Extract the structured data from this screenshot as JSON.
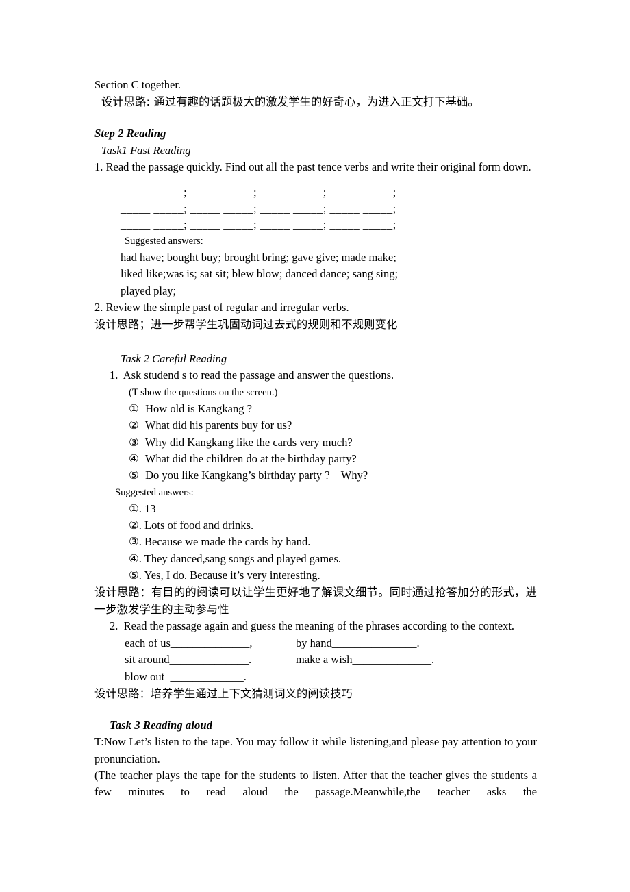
{
  "document": {
    "intro": {
      "line1": "Section C together.",
      "design_note_1": "设计思路: 通过有趣的话题极大的激发学生的好奇心，为进入正文打下基础。"
    },
    "step2": {
      "heading": "Step 2 Reading",
      "task1": {
        "heading": "Task1 Fast Reading",
        "item1_number": "1.",
        "item1_text": "Read the passage quickly. Find out all the past tence verbs and write their original form down.",
        "blank_rows": [
          "_____ _____; _____ _____; _____ _____; _____ _____;",
          "_____ _____; _____ _____; _____ _____; _____ _____;",
          "_____ _____; _____ _____; _____ _____; _____ _____;"
        ],
        "suggested_label": "Suggested answers:",
        "answer_lines": [
          "had have; bought buy; brought bring; gave give; made make;",
          "liked like;was is; sat sit; blew blow; danced dance; sang sing;",
          "played play;"
        ],
        "item2_number": "2.",
        "item2_text": "Review the simple past of regular and irregular verbs.",
        "design_note": "设计思路；进一步帮学生巩固动词过去式的规则和不规则变化"
      },
      "task2": {
        "heading": "Task 2 Careful Reading",
        "item1_number": "1.",
        "item1_text": "Ask studend s to read the passage and answer the questions.",
        "stage_direction": "(T show the questions on the screen.)",
        "questions": [
          {
            "marker": "①",
            "text": "How old is Kangkang ?"
          },
          {
            "marker": "②",
            "text": "What did his parents buy for us?"
          },
          {
            "marker": "③",
            "text": "Why did Kangkang like the cards very much?"
          },
          {
            "marker": "④",
            "text": "What did the children do at the birthday party?"
          },
          {
            "marker": "⑤",
            "text": "Do you like Kangkang’s birthday party ?    Why?"
          }
        ],
        "suggested_label": "Suggested answers:",
        "answers": [
          {
            "marker": "①.",
            "text": "13"
          },
          {
            "marker": "②.",
            "text": "Lots of food and drinks."
          },
          {
            "marker": "③.",
            "text": "Because we made the cards by hand."
          },
          {
            "marker": "④.",
            "text": "They danced,sang songs and played games."
          },
          {
            "marker": "⑤.",
            "text": "Yes, I do. Because it’s very interesting."
          }
        ],
        "design_note": "设计思路：有目的的阅读可以让学生更好地了解课文细节。同时通过抢答加分的形式，进一步激发学生的主动参与性",
        "item2_number": "2.",
        "item2_text": "Read the passage again and guess the meaning of the phrases according to the context.",
        "phrases": [
          {
            "left": "each of us______________,",
            "right": "by hand_______________."
          },
          {
            "left": "sit around______________.",
            "right": "make a wish______________."
          },
          {
            "left": "blow out  _____________.",
            "right": ""
          }
        ],
        "design_note_2": "设计思路：培养学生通过上下文猜测词义的阅读技巧"
      },
      "task3": {
        "heading": "Task 3 Reading aloud",
        "paragraph1": "T:Now Let’s listen to the tape. You may follow it while listening,and please pay attention to your pronunciation.",
        "paragraph2": "(The teacher plays the tape for the students to listen. After that the teacher gives the students a few minutes to read aloud the passage.Meanwhile,the teacher asks the"
      }
    }
  }
}
